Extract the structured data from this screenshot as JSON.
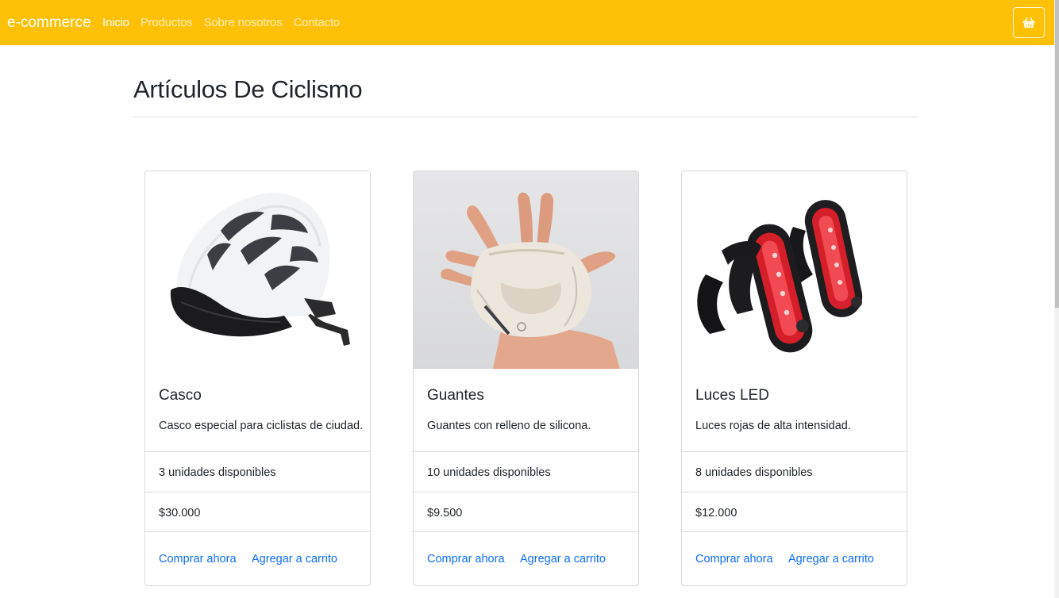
{
  "navbar": {
    "brand": "e-commerce",
    "links": [
      "Inicio",
      "Productos",
      "Sobre nosotros",
      "Contacto"
    ],
    "active_link": "Inicio",
    "cart_icon": "basket-icon",
    "background_color": "#ffc107"
  },
  "page": {
    "title": "Artículos De Ciclismo"
  },
  "products": [
    {
      "name": "Casco",
      "description": "Casco especial para ciclistas de ciudad.",
      "stock": "3 unidades disponibles",
      "price": "$30.000",
      "buy_label": "Comprar ahora",
      "cart_label": "Agregar a carrito",
      "image": "bike-helmet-image"
    },
    {
      "name": "Guantes",
      "description": "Guantes con relleno de silicona.",
      "stock": "10 unidades disponibles",
      "price": "$9.500",
      "buy_label": "Comprar ahora",
      "cart_label": "Agregar a carrito",
      "image": "cycling-glove-image"
    },
    {
      "name": "Luces LED",
      "description": "Luces rojas de alta intensidad.",
      "stock": "8 unidades disponibles",
      "price": "$12.000",
      "buy_label": "Comprar ahora",
      "cart_label": "Agregar a carrito",
      "image": "led-lights-image"
    }
  ],
  "colors": {
    "accent": "#ffc107",
    "link": "#0d6efd"
  }
}
